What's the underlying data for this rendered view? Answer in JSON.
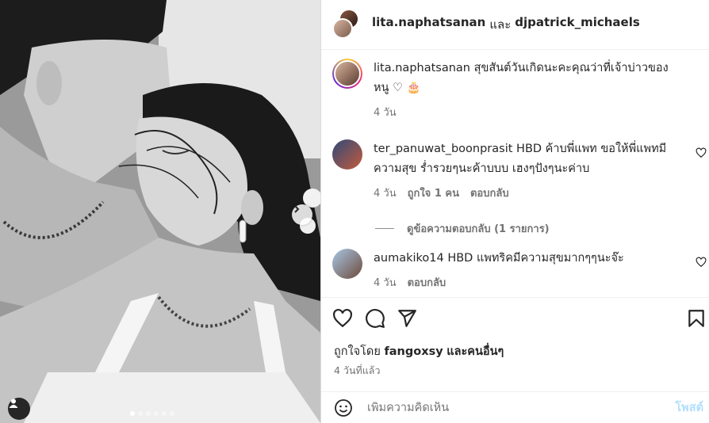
{
  "post": {
    "author_1": "lita.naphatsanan",
    "joiner": "และ",
    "author_2": "djpatrick_michaels"
  },
  "comments": [
    {
      "username": "lita.naphatsanan",
      "text": "สุขสันต์วันเกิดนะคะคุณว่าที่เจ้าบ่าวของหนู ♡ 🎂",
      "time": "4 วัน"
    },
    {
      "username": "ter_panuwat_boonprasit",
      "text": "HBD ค้าบพี่แพท ขอให้พี่แพทมีความสุข ร่ำรวยๆนะค้าบบบ เฮงๆปังๆนะค่าบ",
      "time": "4 วัน",
      "likes": "ถูกใจ 1 คน",
      "reply": "ตอบกลับ",
      "view_replies": "ดูข้อความตอบกลับ (1 รายการ)"
    },
    {
      "username": "aumakiko14",
      "text": "HBD แพทริคมีความสุขมากๆๆนะจ๊ะ",
      "time": "4 วัน",
      "reply": "ตอบกลับ"
    }
  ],
  "likes": {
    "prefix": "ถูกใจโดย",
    "user": "fangoxsy",
    "suffix": "และคนอื่นๆ"
  },
  "date": "4 วันที่แล้ว",
  "add_comment": {
    "placeholder": "เพิ่มความคิดเห็น",
    "post_label": "โพสต์"
  },
  "icons": {
    "like": "heart-icon",
    "comment": "comment-icon",
    "share": "share-icon",
    "save": "bookmark-icon",
    "emoji": "emoji-icon",
    "next": "chevron-right-icon",
    "tag": "person-icon"
  },
  "colors": {
    "post_button": "#b2dffc",
    "muted_text": "#737373"
  },
  "carousel": {
    "slides": 6,
    "active": 1
  }
}
